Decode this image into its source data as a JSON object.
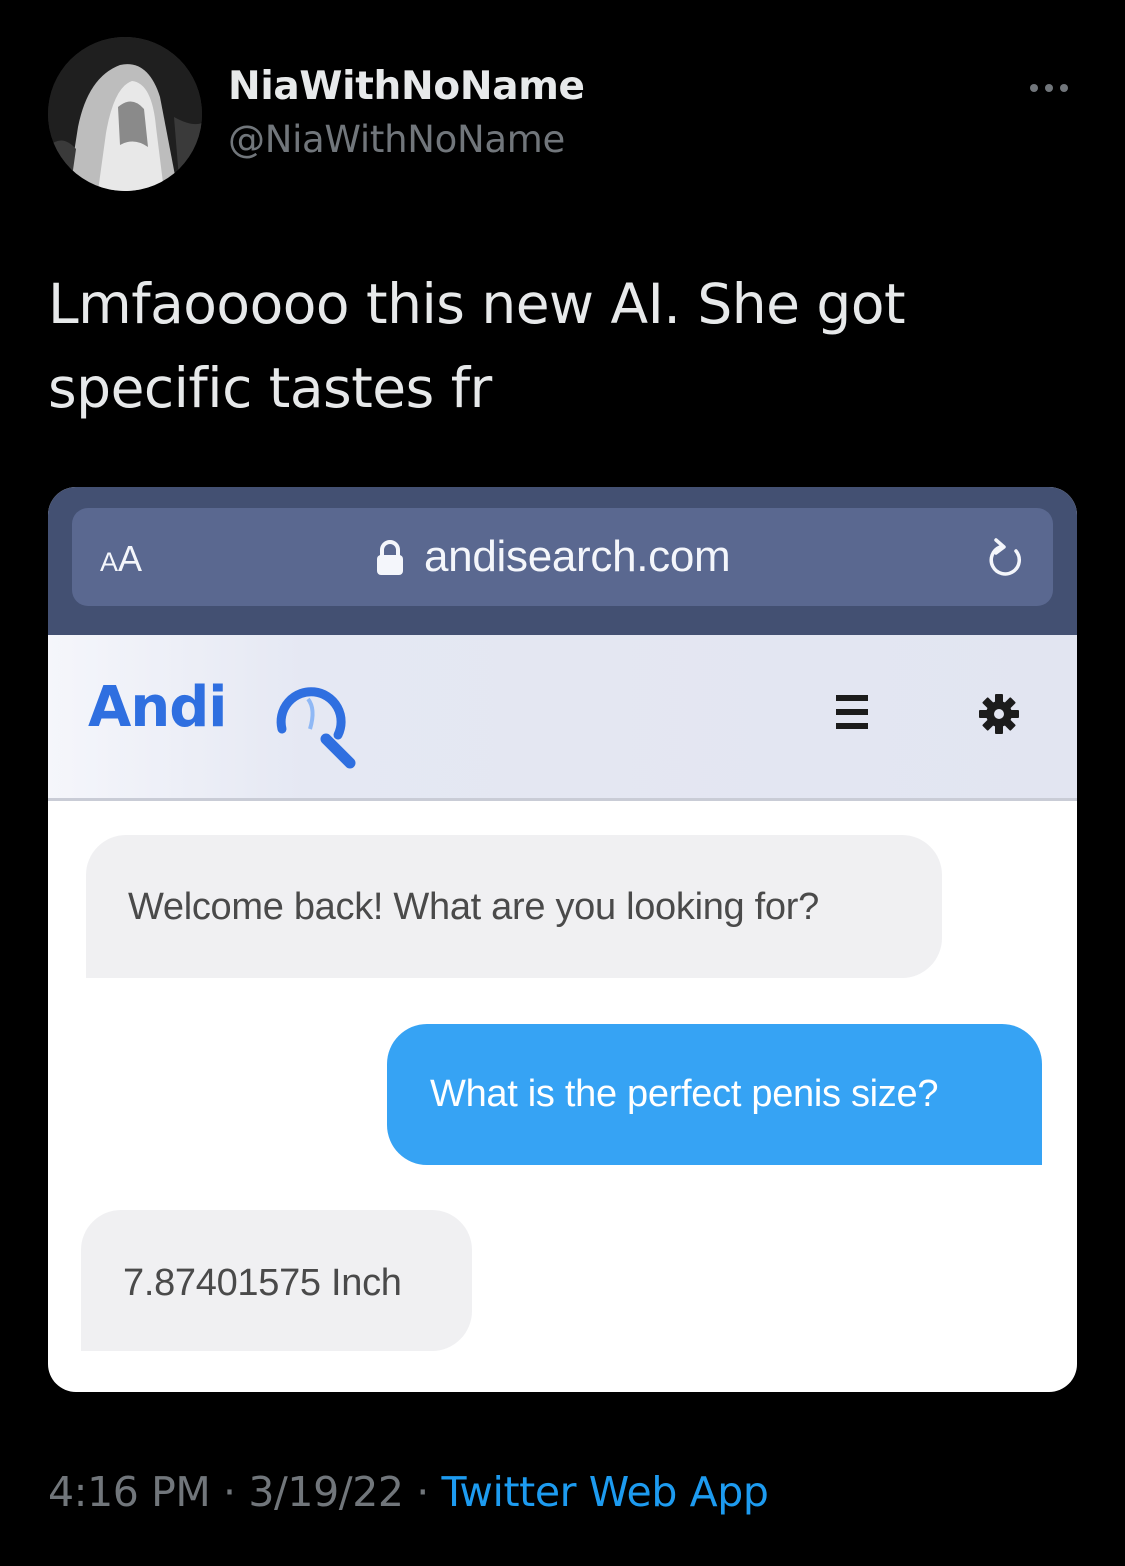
{
  "tweet": {
    "author": {
      "display_name": "NiaWithNoName",
      "handle": "@NiaWithNoName",
      "avatar_icon": "ghost-figure-avatar"
    },
    "more_icon": "more-options-icon",
    "text": "Lmfaooooo this new AI. She got specific tastes fr",
    "timestamp": {
      "time": "4:16 PM",
      "separator": "·",
      "date": "3/19/22",
      "source": "Twitter Web App"
    }
  },
  "screenshot": {
    "browser": {
      "text_size_label": "AA",
      "url": "andisearch.com",
      "lock_icon": "lock-icon",
      "reload_icon": "reload-icon"
    },
    "site": {
      "logo_text": "Andi",
      "menu_icon": "hamburger-menu-icon",
      "settings_icon": "gear-icon"
    },
    "chat": [
      {
        "role": "bot",
        "text": "Welcome back! What are you looking for?"
      },
      {
        "role": "user",
        "text": "What is the perfect penis size?"
      },
      {
        "role": "bot",
        "text": "7.87401575 Inch"
      }
    ]
  },
  "colors": {
    "background": "#000000",
    "primary_text": "#e7e9ea",
    "secondary_text": "#71767b",
    "link": "#1d9bf0",
    "browser_bar": "#435072",
    "andi_blue": "#2f6fe0",
    "user_bubble": "#36a3f4",
    "bot_bubble": "#f0f0f2"
  }
}
